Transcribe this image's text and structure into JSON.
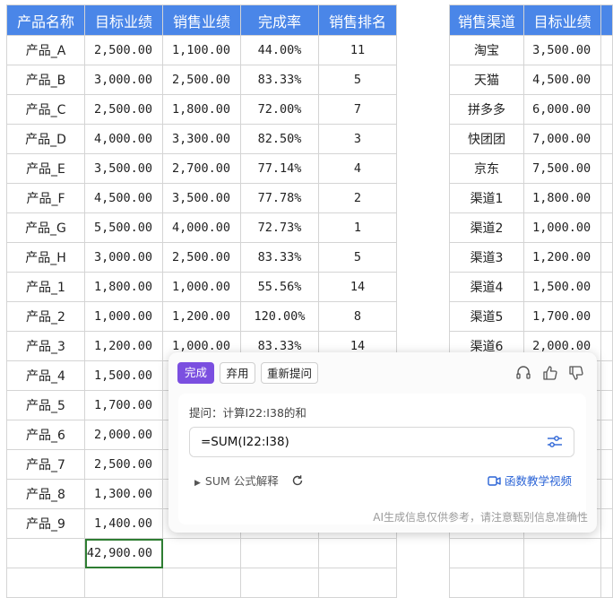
{
  "table1": {
    "headers": [
      "产品名称",
      "目标业绩",
      "销售业绩",
      "完成率",
      "销售排名"
    ],
    "rows": [
      [
        "产品_A",
        "2,500.00",
        "1,100.00",
        "44.00%",
        "11"
      ],
      [
        "产品_B",
        "3,000.00",
        "2,500.00",
        "83.33%",
        "5"
      ],
      [
        "产品_C",
        "2,500.00",
        "1,800.00",
        "72.00%",
        "7"
      ],
      [
        "产品_D",
        "4,000.00",
        "3,300.00",
        "82.50%",
        "3"
      ],
      [
        "产品_E",
        "3,500.00",
        "2,700.00",
        "77.14%",
        "4"
      ],
      [
        "产品_F",
        "4,500.00",
        "3,500.00",
        "77.78%",
        "2"
      ],
      [
        "产品_G",
        "5,500.00",
        "4,000.00",
        "72.73%",
        "1"
      ],
      [
        "产品_H",
        "3,000.00",
        "2,500.00",
        "83.33%",
        "5"
      ],
      [
        "产品_1",
        "1,800.00",
        "1,000.00",
        "55.56%",
        "14"
      ],
      [
        "产品_2",
        "1,000.00",
        "1,200.00",
        "120.00%",
        "8"
      ],
      [
        "产品_3",
        "1,200.00",
        "1,000.00",
        "83.33%",
        "14"
      ],
      [
        "产品_4",
        "1,500.00",
        "",
        "",
        ""
      ],
      [
        "产品_5",
        "1,700.00",
        "",
        "",
        ""
      ],
      [
        "产品_6",
        "2,000.00",
        "",
        "",
        ""
      ],
      [
        "产品_7",
        "2,500.00",
        "",
        "",
        ""
      ],
      [
        "产品_8",
        "1,300.00",
        "",
        "",
        ""
      ],
      [
        "产品_9",
        "1,400.00",
        "",
        "",
        ""
      ],
      [
        "",
        "42,900.00",
        "",
        "",
        ""
      ],
      [
        "",
        "",
        "",
        "",
        ""
      ]
    ]
  },
  "table2": {
    "headers": [
      "销售渠道",
      "目标业绩"
    ],
    "rows": [
      [
        "淘宝",
        "3,500.00"
      ],
      [
        "天猫",
        "4,500.00"
      ],
      [
        "拼多多",
        "6,000.00"
      ],
      [
        "快团团",
        "7,000.00"
      ],
      [
        "京东",
        "7,500.00"
      ],
      [
        "渠道1",
        "1,800.00"
      ],
      [
        "渠道2",
        "1,000.00"
      ],
      [
        "渠道3",
        "1,200.00"
      ],
      [
        "渠道4",
        "1,500.00"
      ],
      [
        "渠道5",
        "1,700.00"
      ],
      [
        "渠道6",
        "2,000.00"
      ],
      [
        "",
        ""
      ],
      [
        "",
        ""
      ],
      [
        "",
        ""
      ],
      [
        "",
        ""
      ],
      [
        "",
        ""
      ],
      [
        "",
        ""
      ],
      [
        "",
        ""
      ],
      [
        "",
        ""
      ]
    ]
  },
  "popup": {
    "done_label": "完成",
    "discard_label": "弃用",
    "reask_label": "重新提问",
    "prompt_text": "提问：计算I22:I38的和",
    "formula": "=SUM(I22:I38)",
    "explain_label": "SUM 公式解释",
    "video_label": "函数教学视频",
    "disclaimer": "AI生成信息仅供参考，请注意甄别信息准确性"
  },
  "colors": {
    "header_bg": "#4a86e8",
    "primary": "#7b4fe0",
    "link": "#2a63d6",
    "selection": "#2e7d32"
  }
}
